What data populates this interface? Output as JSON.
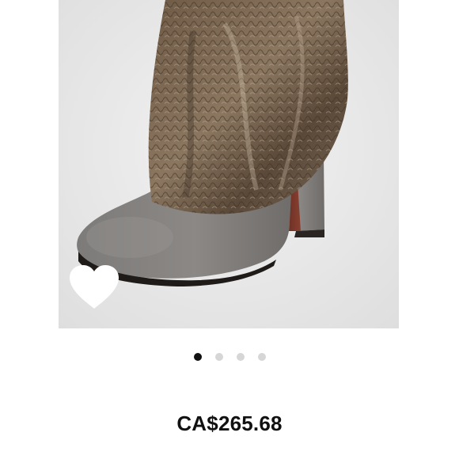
{
  "product": {
    "price": "CA$265.68",
    "image_icon": "boot-photo",
    "favorite_icon": "heart-icon"
  },
  "carousel": {
    "count": 4,
    "active_index": 0
  },
  "colors": {
    "active_dot": "#111111",
    "inactive_dot": "#d6d6d6",
    "heart": "#ffffff"
  }
}
